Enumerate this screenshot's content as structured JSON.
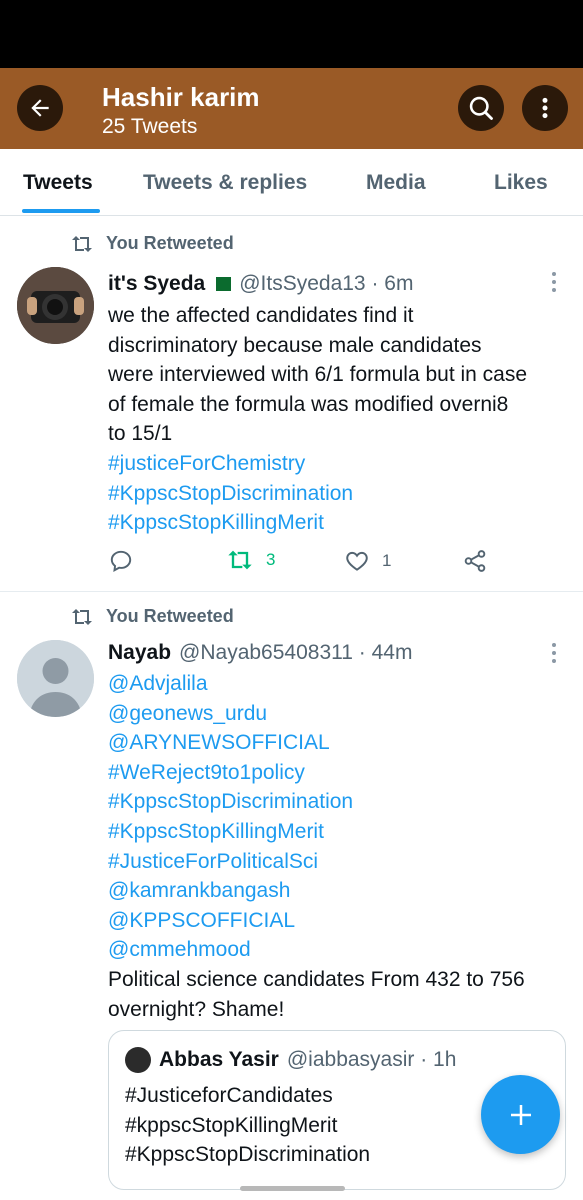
{
  "header": {
    "title": "Hashir karim",
    "subtitle": "25 Tweets",
    "colors": {
      "background": "#9a5a26",
      "button": "#1a1a1a"
    },
    "icons": {
      "back": "arrow-left-icon",
      "search": "search-icon",
      "more": "more-vertical-icon"
    }
  },
  "tabs": [
    {
      "label": "Tweets",
      "active": true
    },
    {
      "label": "Tweets & replies",
      "active": false
    },
    {
      "label": "Media",
      "active": false
    },
    {
      "label": "Likes",
      "active": false
    }
  ],
  "tweets": [
    {
      "retweet_label": "You Retweeted",
      "name": "it's Syeda",
      "handle": "@ItsSyeda13 · 6m",
      "lines": [
        {
          "text": "we the affected candidates find it",
          "link": false
        },
        {
          "text": "discriminatory because male candidates",
          "link": false
        },
        {
          "text": "were interviewed with 6/1 formula but in case",
          "link": false
        },
        {
          "text": "of female the formula was modified overni8",
          "link": false
        },
        {
          "text": "to 15/1",
          "link": false
        },
        {
          "text": "#justiceForChemistry",
          "link": true
        },
        {
          "text": "#KppscStopDiscrimination",
          "link": true
        },
        {
          "text": "#KppscStopKillingMerit",
          "link": true
        }
      ],
      "actions": {
        "reply": "",
        "retweets": "3",
        "likes": "1"
      }
    },
    {
      "retweet_label": "You Retweeted",
      "name": "Nayab",
      "handle": "@Nayab65408311 · 44m",
      "lines": [
        {
          "text": "@Advjalila",
          "link": true
        },
        {
          "text": "@geonews_urdu",
          "link": true
        },
        {
          "text": "@ARYNEWSOFFICIAL",
          "link": true
        },
        {
          "text": "#WeReject9to1policy",
          "link": true
        },
        {
          "text": "#KppscStopDiscrimination",
          "link": true
        },
        {
          "text": "#KppscStopKillingMerit",
          "link": true
        },
        {
          "text": "#JusticeForPoliticalSci",
          "link": true
        },
        {
          "text": "@kamrankbangash",
          "link": true
        },
        {
          "text": "@KPPSCOFFICIAL",
          "link": true
        },
        {
          "text": "@cmmehmood",
          "link": true
        },
        {
          "text": "Political science candidates From 432 to 756",
          "link": false
        },
        {
          "text": "overnight? Shame!",
          "link": false
        }
      ],
      "quote": {
        "name": "Abbas Yasir",
        "handle": "@iabbasyasir · 1h",
        "lines": [
          "#JusticeforCandidates",
          "#kppscStopKillingMerit",
          "#KppscStopDiscrimination"
        ]
      }
    }
  ],
  "fab_icon": "plus-icon",
  "colors": {
    "link": "#1d9bf0",
    "retweet_active": "#00ba7c",
    "muted": "#536471"
  }
}
